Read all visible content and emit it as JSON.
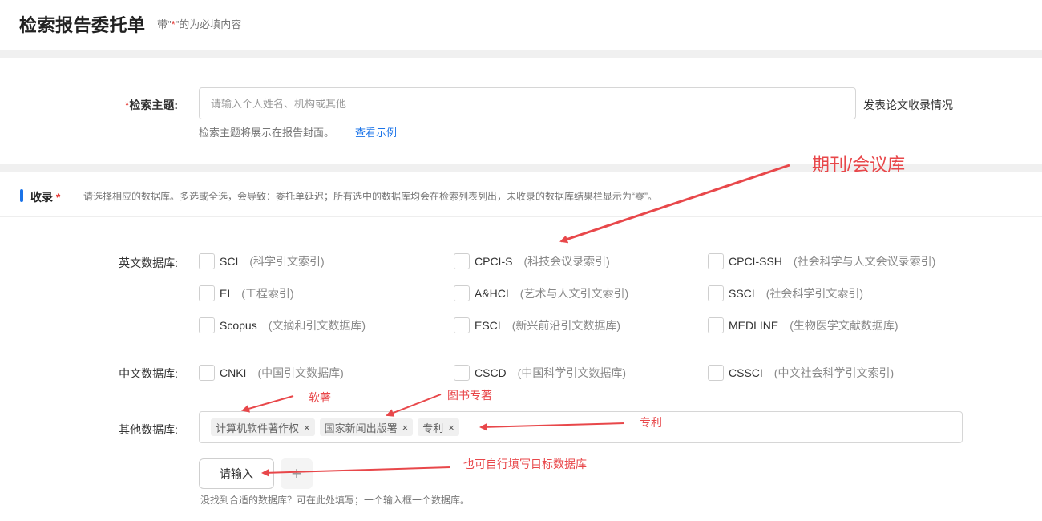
{
  "header": {
    "title": "检索报告委托单",
    "hint_prefix": "带\"",
    "hint_star": "*",
    "hint_suffix": "\"的为必填内容"
  },
  "subject": {
    "star": "*",
    "label": "检索主题:",
    "placeholder": "请输入个人姓名、机构或其他",
    "suffix": "发表论文收录情况",
    "helper": "检索主题将展示在报告封面。",
    "example_link": "查看示例"
  },
  "collection": {
    "title": "收录",
    "star": "*",
    "description": "请选择相应的数据库。多选或全选，会导致：委托单延迟；所有选中的数据库均会在检索列表列出，未收录的数据库结果栏显示为“零”。"
  },
  "english_db": {
    "label": "英文数据库:",
    "items": [
      {
        "name": "SCI",
        "desc": "(科学引文索引)"
      },
      {
        "name": "CPCI-S",
        "desc": "(科技会议录索引)"
      },
      {
        "name": "CPCI-SSH",
        "desc": "(社会科学与人文会议录索引)"
      },
      {
        "name": "EI",
        "desc": "(工程索引)"
      },
      {
        "name": "A&HCI",
        "desc": "(艺术与人文引文索引)"
      },
      {
        "name": "SSCI",
        "desc": "(社会科学引文索引)"
      },
      {
        "name": "Scopus",
        "desc": "(文摘和引文数据库)"
      },
      {
        "name": "ESCI",
        "desc": "(新兴前沿引文数据库)"
      },
      {
        "name": "MEDLINE",
        "desc": "(生物医学文献数据库)"
      }
    ]
  },
  "chinese_db": {
    "label": "中文数据库:",
    "items": [
      {
        "name": "CNKI",
        "desc": "(中国引文数据库)"
      },
      {
        "name": "CSCD",
        "desc": "(中国科学引文数据库)"
      },
      {
        "name": "CSSCI",
        "desc": "(中文社会科学引文索引)"
      }
    ]
  },
  "other_db": {
    "label": "其他数据库:",
    "tags": [
      "计算机软件著作权",
      "国家新闻出版署",
      "专利"
    ],
    "close_symbol": "×",
    "input_placeholder": "请输入",
    "add_symbol": "+",
    "hint": "没找到合适的数据库？可在此处填写；一个输入框一个数据库。"
  },
  "annotations": {
    "journal": "期刊/会议库",
    "software": "软著",
    "book": "图书专著",
    "patent": "专利",
    "custom": "也可自行填写目标数据库"
  },
  "colors": {
    "accent": "#1a73e8",
    "required": "#e53935",
    "annotation": "#e8474a"
  }
}
